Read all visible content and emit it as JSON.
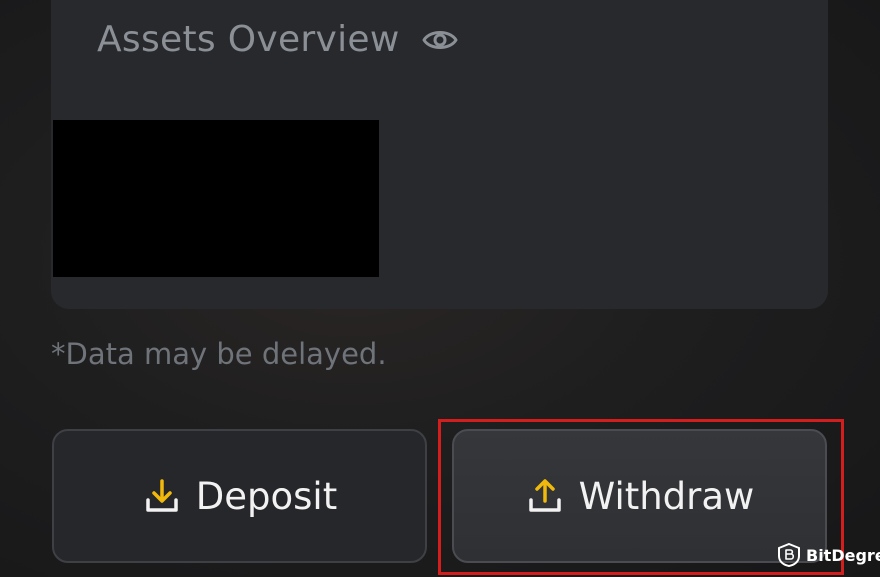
{
  "card": {
    "title": "Assets Overview",
    "visibility_icon": "eye-icon"
  },
  "disclaimer": "*Data may be delayed.",
  "actions": {
    "deposit": {
      "label": "Deposit",
      "icon": "download-icon"
    },
    "withdraw": {
      "label": "Withdraw",
      "icon": "upload-icon"
    }
  },
  "watermark": {
    "text": "BitDegree"
  },
  "colors": {
    "accent": "#f0b90b",
    "highlight": "#d41e1e",
    "card_bg": "#28292c",
    "muted_text": "#6f737a"
  }
}
